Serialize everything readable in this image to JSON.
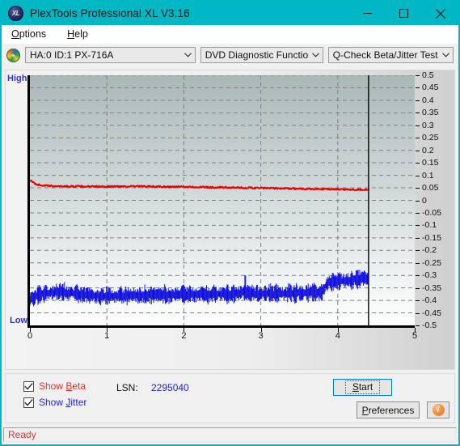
{
  "window": {
    "title": "PlexTools Professional XL V3.16",
    "app_icon": "xl-disc-icon",
    "minimize": "minimize-icon",
    "maximize": "maximize-icon",
    "close": "close-icon",
    "titlebar_color": "#00b7c3"
  },
  "menu": [
    {
      "label": "Options",
      "mnemonic": "O"
    },
    {
      "label": "Help",
      "mnemonic": "H"
    }
  ],
  "toolbar": {
    "drive_icon": "optical-disc-icon",
    "drive_combo": {
      "value": "HA:0 ID:1  PX-716A"
    },
    "function_combo": {
      "value": "DVD Diagnostic Functions"
    },
    "test_combo": {
      "value": "Q-Check Beta/Jitter Test"
    }
  },
  "options_panel": {
    "show_beta": {
      "label": "Show Beta",
      "checked": true,
      "color": "#e03030"
    },
    "show_jitter": {
      "label": "Show Jitter",
      "checked": true,
      "color": "#2222cc"
    },
    "lsn_label": "LSN:",
    "lsn_value": "2295040",
    "start_button": "Start",
    "preferences_button": "Preferences",
    "info_button": "info-icon"
  },
  "statusbar": {
    "text": "Ready"
  },
  "chart_data": {
    "type": "line",
    "title": "Q-Check Beta/Jitter Test",
    "xlabel": "",
    "ylabel": "",
    "xlim": [
      0,
      5
    ],
    "ylim": [
      -0.5,
      0.5
    ],
    "grid": true,
    "legend": "none",
    "x_ticks": [
      "0",
      "1",
      "2",
      "3",
      "4",
      "5"
    ],
    "y_ticks": [
      "0.5",
      "0.45",
      "0.4",
      "0.35",
      "0.3",
      "0.25",
      "0.2",
      "0.15",
      "0.1",
      "0.05",
      "0",
      "-0.05",
      "-0.1",
      "-0.15",
      "-0.2",
      "-0.25",
      "-0.3",
      "-0.35",
      "-0.4",
      "-0.45",
      "-0.5"
    ],
    "axis_annotations": {
      "top_left": "High",
      "bottom_left": "Low"
    },
    "cursor_line_x": 4.4,
    "data_end_x": 4.4,
    "series": [
      {
        "name": "Beta",
        "color": "#ee0000",
        "x": [
          0.0,
          0.03,
          0.06,
          0.1,
          0.16,
          0.24,
          0.34,
          0.48,
          0.64,
          0.82,
          1.0,
          1.2,
          1.4,
          1.6,
          1.8,
          2.0,
          2.2,
          2.4,
          2.6,
          2.8,
          3.0,
          3.2,
          3.4,
          3.6,
          3.8,
          4.0,
          4.2,
          4.4
        ],
        "values": [
          0.08,
          0.074,
          0.068,
          0.063,
          0.06,
          0.058,
          0.057,
          0.056,
          0.056,
          0.055,
          0.055,
          0.056,
          0.056,
          0.055,
          0.054,
          0.054,
          0.053,
          0.052,
          0.051,
          0.05,
          0.049,
          0.048,
          0.047,
          0.046,
          0.045,
          0.044,
          0.043,
          0.043
        ],
        "noise": 0.003
      },
      {
        "name": "Jitter",
        "color": "#1010dd",
        "x": [
          0.0,
          0.1,
          0.2,
          0.3,
          0.4,
          0.5,
          0.6,
          0.7,
          0.8,
          0.9,
          1.0,
          1.2,
          1.4,
          1.6,
          1.8,
          2.0,
          2.2,
          2.4,
          2.6,
          2.8,
          3.0,
          3.2,
          3.4,
          3.6,
          3.8,
          3.86,
          4.0,
          4.2,
          4.4
        ],
        "values": [
          -0.395,
          -0.38,
          -0.372,
          -0.368,
          -0.366,
          -0.37,
          -0.374,
          -0.378,
          -0.38,
          -0.382,
          -0.383,
          -0.382,
          -0.38,
          -0.379,
          -0.378,
          -0.377,
          -0.376,
          -0.375,
          -0.374,
          -0.368,
          -0.374,
          -0.373,
          -0.372,
          -0.37,
          -0.368,
          -0.33,
          -0.325,
          -0.318,
          -0.31
        ],
        "band": 0.03,
        "step_x": 3.86,
        "spike_x": 2.8,
        "spike_y": -0.3
      }
    ]
  }
}
